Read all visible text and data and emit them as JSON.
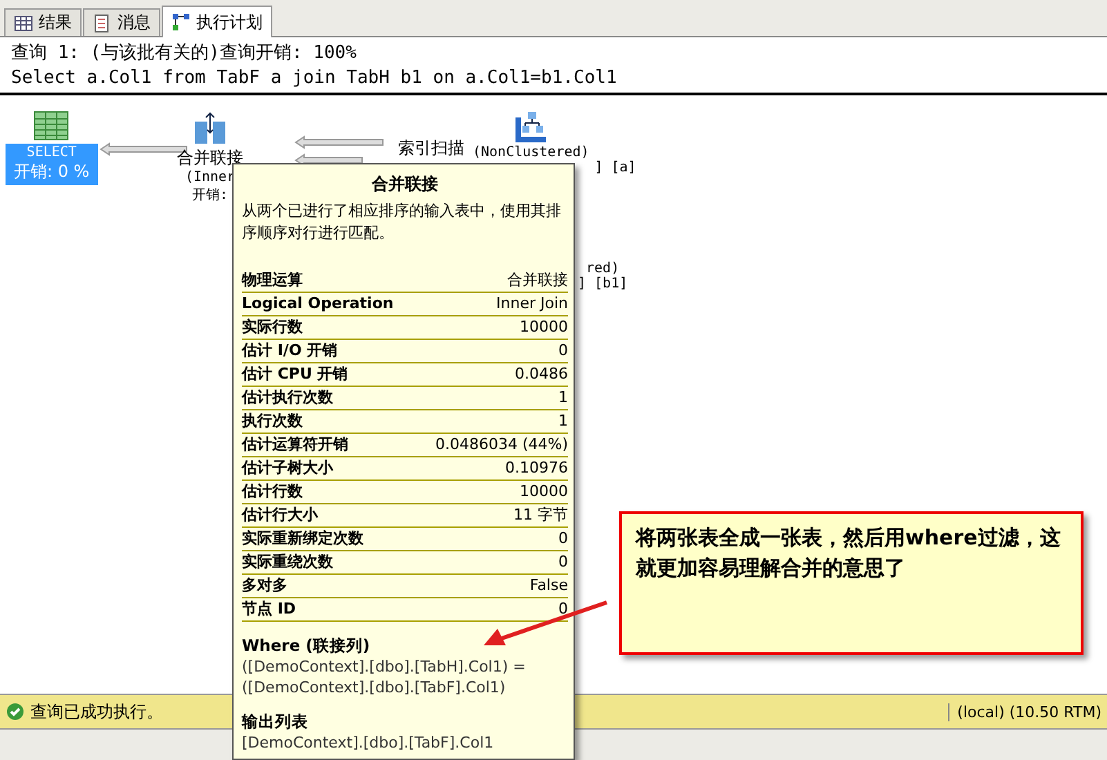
{
  "tabs": [
    {
      "label": "结果",
      "selected": false
    },
    {
      "label": "消息",
      "selected": false
    },
    {
      "label": "执行计划",
      "selected": true
    }
  ],
  "query": {
    "title": "查询 1: (与该批有关的)查询开销: 100%",
    "sql": "Select a.Col1 from TabF a join TabH b1 on a.Col1=b1.Col1"
  },
  "plan": {
    "nodes": [
      {
        "kind": "select",
        "lines": [
          "SELECT",
          "开销: 0 %"
        ],
        "selected": true
      },
      {
        "kind": "merge",
        "lines": [
          "合并联接",
          "(Inner",
          "开销:"
        ],
        "selected": false
      },
      {
        "kind": "scan",
        "lines": [
          "索引扫描",
          "(NonClustered)",
          "] [a]"
        ],
        "selected": false
      },
      {
        "kind": "scan_hidden",
        "lines": [
          "red)",
          "] [b1]"
        ],
        "selected": false
      }
    ]
  },
  "tooltip": {
    "title": "合并联接",
    "description": "从两个已进行了相应排序的输入表中，使用其排序顺序对行进行匹配。",
    "rows": [
      {
        "name": "物理运算",
        "value": "合并联接"
      },
      {
        "name": "Logical Operation",
        "value": "Inner Join"
      },
      {
        "name": "实际行数",
        "value": "10000"
      },
      {
        "name": "估计 I/O 开销",
        "value": "0"
      },
      {
        "name": "估计 CPU 开销",
        "value": "0.0486"
      },
      {
        "name": "估计执行次数",
        "value": "1"
      },
      {
        "name": "执行次数",
        "value": "1"
      },
      {
        "name": "估计运算符开销",
        "value": "0.0486034 (44%)"
      },
      {
        "name": "估计子树大小",
        "value": "0.10976"
      },
      {
        "name": "估计行数",
        "value": "10000"
      },
      {
        "name": "估计行大小",
        "value": "11 字节"
      },
      {
        "name": "实际重新绑定次数",
        "value": "0"
      },
      {
        "name": "实际重绕次数",
        "value": "0"
      },
      {
        "name": "多对多",
        "value": "False"
      },
      {
        "name": "节点 ID",
        "value": "0"
      }
    ],
    "sections": [
      {
        "heading": "Where (联接列)",
        "text": "([DemoContext].[dbo].[TabH].Col1) = ([DemoContext].[dbo].[TabF].Col1)"
      },
      {
        "heading": "输出列表",
        "text": "[DemoContext].[dbo].[TabF].Col1"
      }
    ]
  },
  "callout": {
    "text": "将两张表全成一张表，然后用where过滤，这就更加容易理解合并的意思了"
  },
  "status_bar": {
    "message": "查询已成功执行。",
    "server": "(local) (10.50 RTM)"
  }
}
